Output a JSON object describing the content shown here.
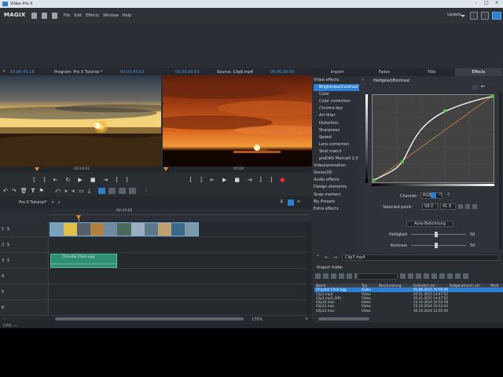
{
  "window": {
    "title": "Video Pro X"
  },
  "menubar": {
    "logo": "MAGIX",
    "menus": [
      "File",
      "Edit",
      "Effects",
      "Window",
      "Help"
    ],
    "update_label": "Update"
  },
  "program_monitor": {
    "timecode_left": "00:00:45:18",
    "title": "Program: Pro X Tutorial *",
    "timecode_right": "00:00:43:02",
    "scrub_time": "00:43:02"
  },
  "source_monitor": {
    "timecode_left": "00:00:00:00",
    "title": "Source: Clip9.mp4",
    "timecode_right": "00:00:30:00",
    "scrub_time": "00:00"
  },
  "tabs": [
    "Import",
    "Fades",
    "Title",
    "Effects"
  ],
  "effects": {
    "category": "Video effects",
    "items": [
      "Brightness/Contrast",
      "Color",
      "Color correction",
      "Chroma key",
      "Art filter",
      "Distortion",
      "Sharpness",
      "Speed",
      "Lens correction",
      "Shot match",
      "proDAD Mercalli 2.0"
    ],
    "categories": [
      "Video/animation",
      "Stereo3D",
      "Audio effects",
      "Design elements",
      "Snap markers",
      "My Presets",
      "Extra effects"
    ],
    "selected": "Brightness/Contrast"
  },
  "curve_panel": {
    "title": "Helligkeit/Kontrast",
    "channel_label": "Channel:",
    "channel_value": "RGB",
    "point_label": "Selected point:",
    "point_x": "58.0",
    "point_y": "41.9",
    "auto_label": "Auto-Belichtung",
    "slider1_label": "Helligkeit",
    "slider1_value": "50",
    "slider2_label": "Kontrast",
    "slider2_value": "50",
    "grid_labels": [
      "1.0",
      "0.8",
      "0.6",
      "0.4",
      "0.2"
    ]
  },
  "timeline": {
    "project_tab": "Pro X Tutorial*",
    "ruler_time": "00:43:02",
    "zoom": "170%",
    "audio_clip_name": "Chrystal Choir.ogg",
    "track_numbers": [
      "1",
      "2",
      "3",
      "4",
      "5",
      "6"
    ],
    "track_label": "S"
  },
  "explorer": {
    "path": "Clip7.mp4",
    "folder_label": "Project folder",
    "columns": [
      "Name",
      "Typ",
      "Beschreibung",
      "Geändert am",
      "Aufgenommen am",
      "Medi"
    ],
    "rows": [
      [
        "Chrystal Choir.ogg",
        "Audio",
        "",
        "05.06.2015 10:59:06",
        ""
      ],
      [
        "Clip1.mp4",
        "Video",
        "",
        "05.01.2015 14:47:52",
        ""
      ],
      [
        "Clip1.mp4_(00)",
        "Video",
        "",
        "05.01.2015 14:47:52",
        ""
      ],
      [
        "Clip10.mov",
        "Video",
        "",
        "23.10.2014 10:10:58",
        ""
      ],
      [
        "Clip11.mov",
        "Video",
        "",
        "23.10.2014 10:12:43",
        ""
      ],
      [
        "Clip12.mov",
        "Video",
        "",
        "30.10.2014 14:02:06",
        ""
      ]
    ]
  },
  "status": {
    "text": "CPU: —"
  },
  "colors": {
    "accent": "#2e7fcf",
    "timecode": "#e5892a",
    "audio_clip": "#2f8f74"
  }
}
